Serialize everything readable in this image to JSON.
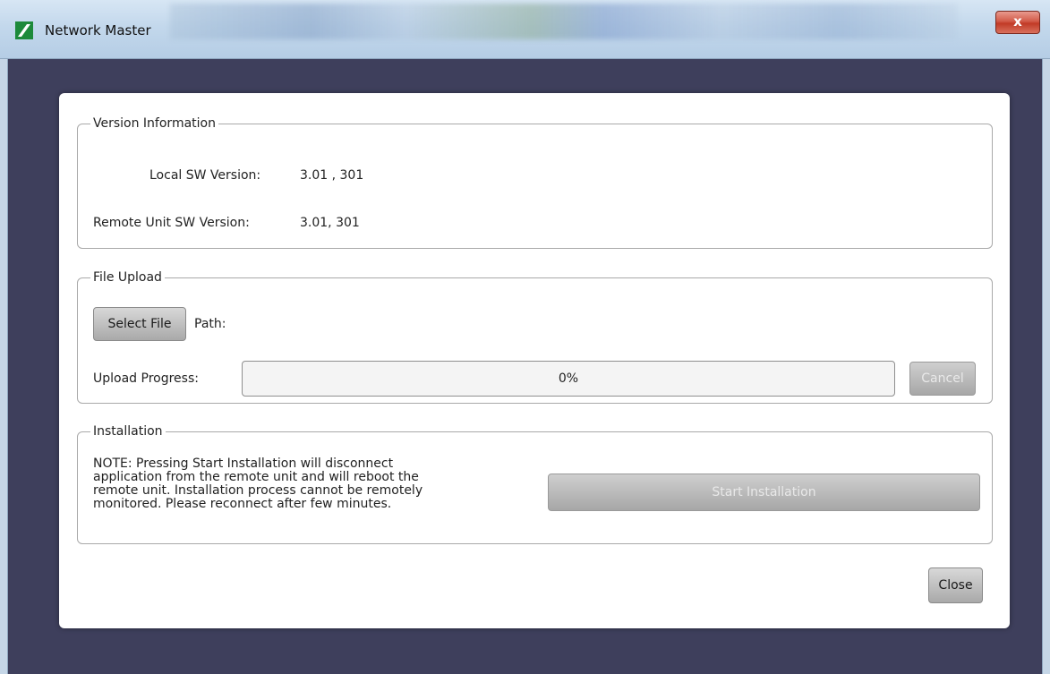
{
  "window": {
    "title": "Network Master",
    "close_glyph": "x",
    "icon": "network-master-logo-icon"
  },
  "version_info": {
    "legend": "Version Information",
    "local_label": "Local SW Version:",
    "local_value": "3.01 , 301",
    "remote_label": "Remote Unit SW Version:",
    "remote_value": "3.01, 301"
  },
  "file_upload": {
    "legend": "File Upload",
    "select_button": "Select File",
    "path_label": "Path:",
    "path_value": "",
    "progress_label": "Upload Progress:",
    "progress_percent": 0,
    "progress_text": "0%",
    "cancel_button": "Cancel"
  },
  "installation": {
    "legend": "Installation",
    "note_lines": [
      "NOTE: Pressing Start Installation will disconnect",
      "application from the remote unit and will reboot the",
      "remote unit. Installation process cannot be remotely",
      "monitored. Please reconnect after few minutes."
    ],
    "start_button": "Start Installation"
  },
  "footer": {
    "close_button": "Close"
  },
  "colors": {
    "backdrop": "#3e3f5c",
    "dialog": "#ffffff",
    "logo_green": "#1d8a3a",
    "close_red": "#c13a26"
  }
}
